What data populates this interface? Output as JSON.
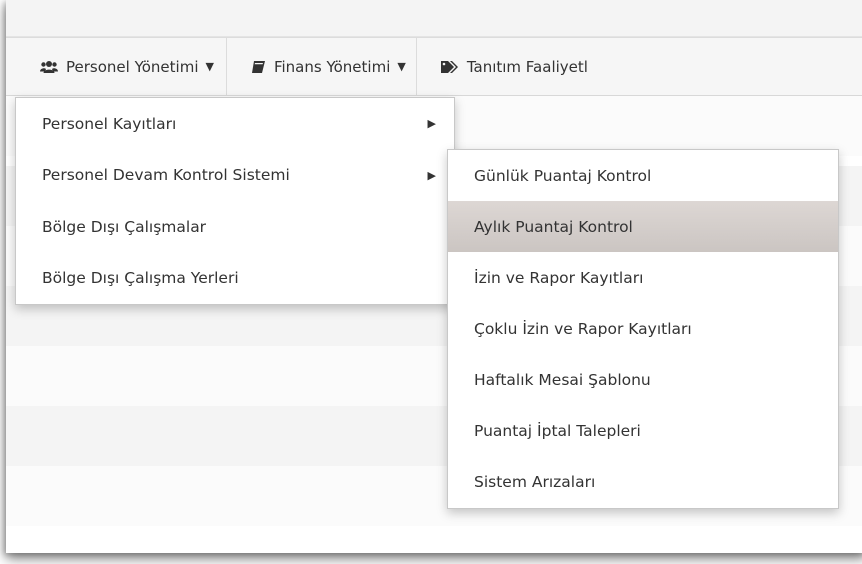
{
  "navbar": {
    "items": [
      {
        "label": "Personel Yönetimi",
        "icon": "users-icon",
        "caret": "▼"
      },
      {
        "label": "Finans Yönetimi",
        "icon": "book-icon",
        "caret": "▼"
      },
      {
        "label": "Tanıtım Faaliyetl",
        "icon": "tags-icon"
      }
    ]
  },
  "menu": {
    "items": [
      {
        "label": "Personel Kayıtları",
        "arrow": "▶"
      },
      {
        "label": "Personel Devam Kontrol Sistemi",
        "arrow": "▶"
      },
      {
        "label": "Bölge Dışı Çalışmalar"
      },
      {
        "label": "Bölge Dışı Çalışma Yerleri"
      }
    ]
  },
  "submenu": {
    "items": [
      {
        "label": "Günlük Puantaj Kontrol"
      },
      {
        "label": "Aylık Puantaj Kontrol",
        "highlighted": true
      },
      {
        "label": "İzin ve Rapor Kayıtları"
      },
      {
        "label": "Çoklu İzin ve Rapor Kayıtları"
      },
      {
        "label": "Haftalık Mesai Şablonu"
      },
      {
        "label": "Puantaj İptal Talepleri"
      },
      {
        "label": "Sistem Arızaları"
      }
    ]
  }
}
